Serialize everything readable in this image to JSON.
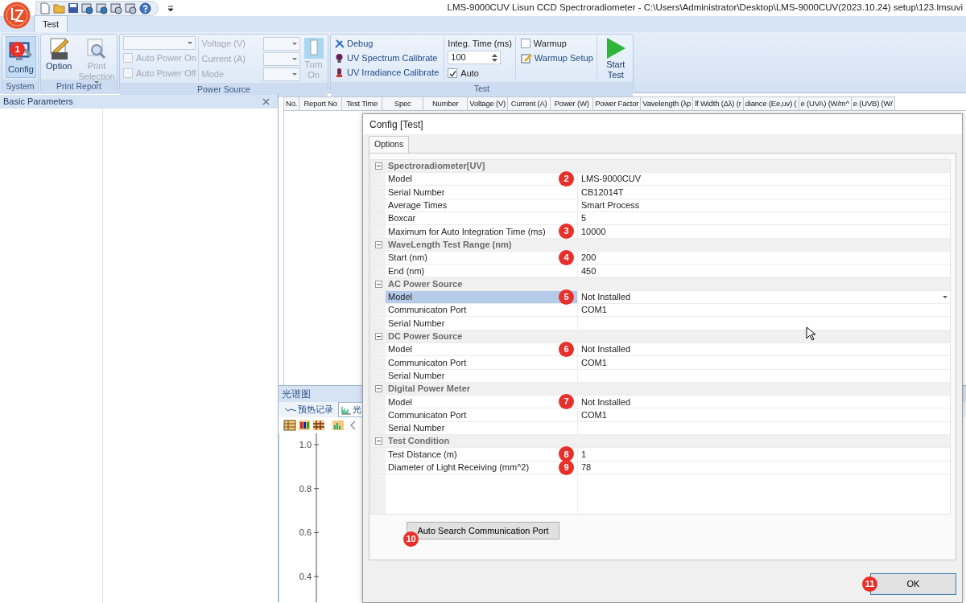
{
  "window": {
    "title": "LMS-9000CUV Lisun CCD Spectroradiometer - C:\\Users\\Administrator\\Desktop\\LMS-9000CUV(2023.10.24) setup\\123.lmsuvi"
  },
  "ribbon": {
    "tabs": [
      {
        "label": "Test",
        "selected": true
      }
    ],
    "system": {
      "title": "System",
      "button": {
        "label": "Config",
        "marker": "1",
        "disabled": false
      }
    },
    "print_report": {
      "title": "Print Report",
      "buttons": [
        {
          "label": "Option",
          "disabled": false
        },
        {
          "label": "Print Selection",
          "disabled": true
        }
      ]
    },
    "power_source": {
      "title": "Power Source",
      "checks": [
        {
          "label": "Auto Power On",
          "checked": false,
          "disabled": true
        },
        {
          "label": "Auto Power Off",
          "checked": false,
          "disabled": true
        }
      ],
      "fields": [
        {
          "label": "Voltage (V)",
          "disabled": true
        },
        {
          "label": "Current (A)",
          "disabled": true
        },
        {
          "label": "Mode",
          "disabled": true
        }
      ],
      "button": {
        "label": "Turn On",
        "disabled": true
      }
    },
    "test": {
      "title": "Test",
      "links": [
        {
          "label": "Debug"
        },
        {
          "label": "UV Spectrum Calibrate"
        },
        {
          "label": "UV Irradiance Calibrate"
        }
      ],
      "integ_time": {
        "label": "Integ. Time (ms)",
        "value": "100"
      },
      "auto": {
        "label": "Auto",
        "checked": true
      },
      "warmup": {
        "label": "Warmup",
        "checked": false
      },
      "warmup_setup": {
        "label": "Warmup Setup"
      },
      "start": {
        "label": "Start Test"
      }
    }
  },
  "left_panel": {
    "title": "Basic Parameters"
  },
  "table": {
    "columns": [
      "No.",
      "Report No",
      "Test Time",
      "Spec",
      "Number",
      "Voltage (V)",
      "Current (A)",
      "Power (W)",
      "Power Factor",
      "Vavelength (λp",
      "lf Width (Δλ) (r",
      "diance (Ee,uv) (",
      "e (UVA) (W/m^",
      "e (UVB) (W/"
    ]
  },
  "spectrum_panel": {
    "title": "光谱图",
    "tabs": [
      {
        "label": "预热记录",
        "selected": false
      },
      {
        "label": "光",
        "selected": true
      }
    ],
    "axis_labels": [
      "1.0",
      "0.8",
      "0.6",
      "0.4"
    ]
  },
  "dialog": {
    "title": "Config [Test]",
    "tabs": [
      {
        "label": "Options",
        "selected": true
      }
    ],
    "categories": [
      {
        "label": "Spectroradiometer[UV]",
        "expanded": true,
        "rows": [
          {
            "name": "Model",
            "value": "LMS-9000CUV",
            "marker": "2",
            "selected": false
          },
          {
            "name": "Serial Number",
            "value": "CB12014T",
            "selected": false
          },
          {
            "name": "Average Times",
            "value": "Smart Process",
            "selected": false
          },
          {
            "name": "Boxcar",
            "value": "5",
            "selected": false
          },
          {
            "name": "Maximum for Auto Integration Time (ms)",
            "value": "10000",
            "marker": "3",
            "selected": false
          }
        ]
      },
      {
        "label": "WaveLength Test Range (nm)",
        "expanded": true,
        "rows": [
          {
            "name": "Start (nm)",
            "value": "200",
            "marker": "4",
            "selected": false
          },
          {
            "name": "End (nm)",
            "value": "450",
            "selected": false
          }
        ]
      },
      {
        "label": "AC Power Source",
        "expanded": true,
        "rows": [
          {
            "name": "Model",
            "value": "Not Installed",
            "marker": "5",
            "selected": true
          },
          {
            "name": "Communicaton Port",
            "value": "COM1",
            "selected": false
          },
          {
            "name": "Serial Number",
            "selected": false
          }
        ]
      },
      {
        "label": "DC Power Source",
        "expanded": true,
        "rows": [
          {
            "name": "Model",
            "value": "Not Installed",
            "marker": "6",
            "selected": false
          },
          {
            "name": "Communicaton Port",
            "value": "COM1",
            "selected": false
          },
          {
            "name": "Serial Number",
            "selected": false
          }
        ]
      },
      {
        "label": "Digital Power Meter",
        "expanded": true,
        "rows": [
          {
            "name": "Model",
            "value": "Not Installed",
            "marker": "7",
            "selected": false
          },
          {
            "name": "Communicaton Port",
            "value": "COM1",
            "selected": false
          },
          {
            "name": "Serial Number",
            "selected": false
          }
        ]
      },
      {
        "label": "Test Condition",
        "expanded": true,
        "rows": [
          {
            "name": "Test Distance (m)",
            "value": "1",
            "marker": "8",
            "selected": false
          },
          {
            "name": "Diameter of Light Receiving (mm^2)",
            "value": "78",
            "marker": "9",
            "selected": false
          }
        ]
      }
    ],
    "search_button": {
      "label": "Auto Search Communication Port",
      "marker": "10"
    },
    "ok_button": {
      "label": "OK",
      "marker": "11"
    }
  }
}
